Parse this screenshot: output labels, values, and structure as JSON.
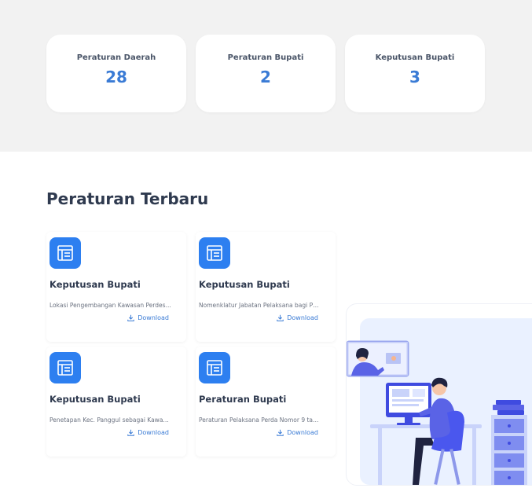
{
  "stats": [
    {
      "label": "Peraturan Daerah",
      "value": "28"
    },
    {
      "label": "Peraturan Bupati",
      "value": "2"
    },
    {
      "label": "Keputusan Bupati",
      "value": "3"
    }
  ],
  "latest": {
    "title": "Peraturan Terbaru",
    "download_label": "Download",
    "items": [
      {
        "type": "Keputusan Bupati",
        "desc": "Lokasi Pengembangan Kawasan Perdes..."
      },
      {
        "type": "Keputusan Bupati",
        "desc": "Nomenklatur Jabatan Pelaksana bagi PNS"
      },
      {
        "type": "Keputusan Bupati",
        "desc": "Penetapan Kec. Panggul sebagai Kawas..."
      },
      {
        "type": "Peraturan Bupati",
        "desc": "Peraturan Pelaksana Perda Nomor 9 tah..."
      }
    ]
  },
  "colors": {
    "accent": "#3a7bd5",
    "icon_bg": "#2d7ff0",
    "band": "#f2f2f2"
  }
}
